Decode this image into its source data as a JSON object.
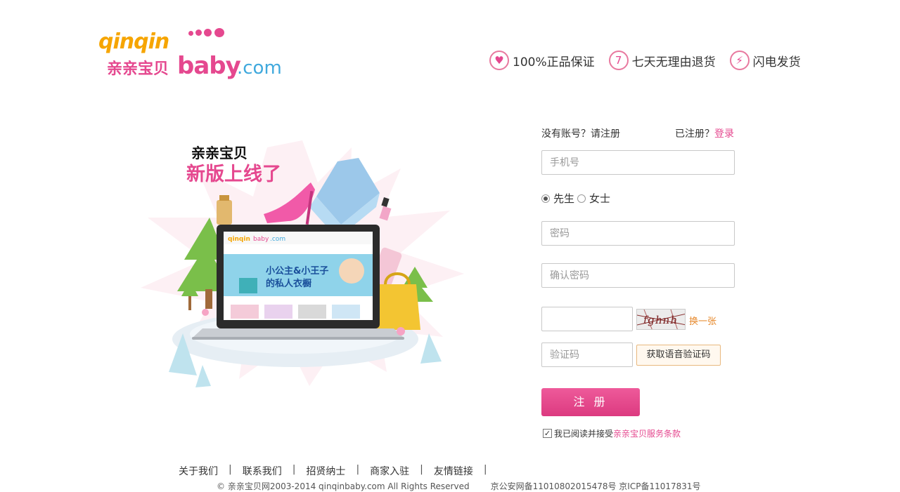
{
  "header": {
    "logo": {
      "en": "qinqin",
      "cn": "亲亲宝贝",
      "baby": "baby",
      "com": ".com"
    },
    "promises": [
      {
        "icon": "shield-icon",
        "glyph": "♥",
        "label": "100%正品保证"
      },
      {
        "icon": "seven-icon",
        "glyph": "7",
        "label": "七天无理由退货"
      },
      {
        "icon": "lightning-icon",
        "glyph": "⚡",
        "label": "闪电发货"
      }
    ]
  },
  "illustration": {
    "line1": "亲亲宝贝",
    "line2": "新版上线了"
  },
  "form": {
    "no_account": "没有账号？请注册",
    "has_account": "已注册？",
    "login_link": "登录",
    "phone_placeholder": "手机号",
    "gender": {
      "male": "先生",
      "female": "女士",
      "selected": "male"
    },
    "password_placeholder": "密码",
    "confirm_placeholder": "确认密码",
    "captcha_text": "fghnh",
    "captcha_swap": "换一张",
    "sms_placeholder": "验证码",
    "voice_button": "获取语音验证码",
    "register_button": "注 册",
    "agree_text": "我已阅读并接受",
    "terms_link": "亲亲宝贝服务条款",
    "agree_checked": true
  },
  "footer": {
    "links": [
      "关于我们",
      "联系我们",
      "招贤纳士",
      "商家入驻",
      "友情链接"
    ],
    "copyright": "© 亲亲宝贝网2003-2014 qinqinbaby.com All Rights Reserved",
    "icp": "京公安网备11010802015478号 京ICP备11017831号"
  },
  "colors": {
    "brand_pink": "#e5488f",
    "brand_orange": "#f6a500",
    "brand_blue": "#40a9dd",
    "swap_orange": "#e6882b"
  }
}
